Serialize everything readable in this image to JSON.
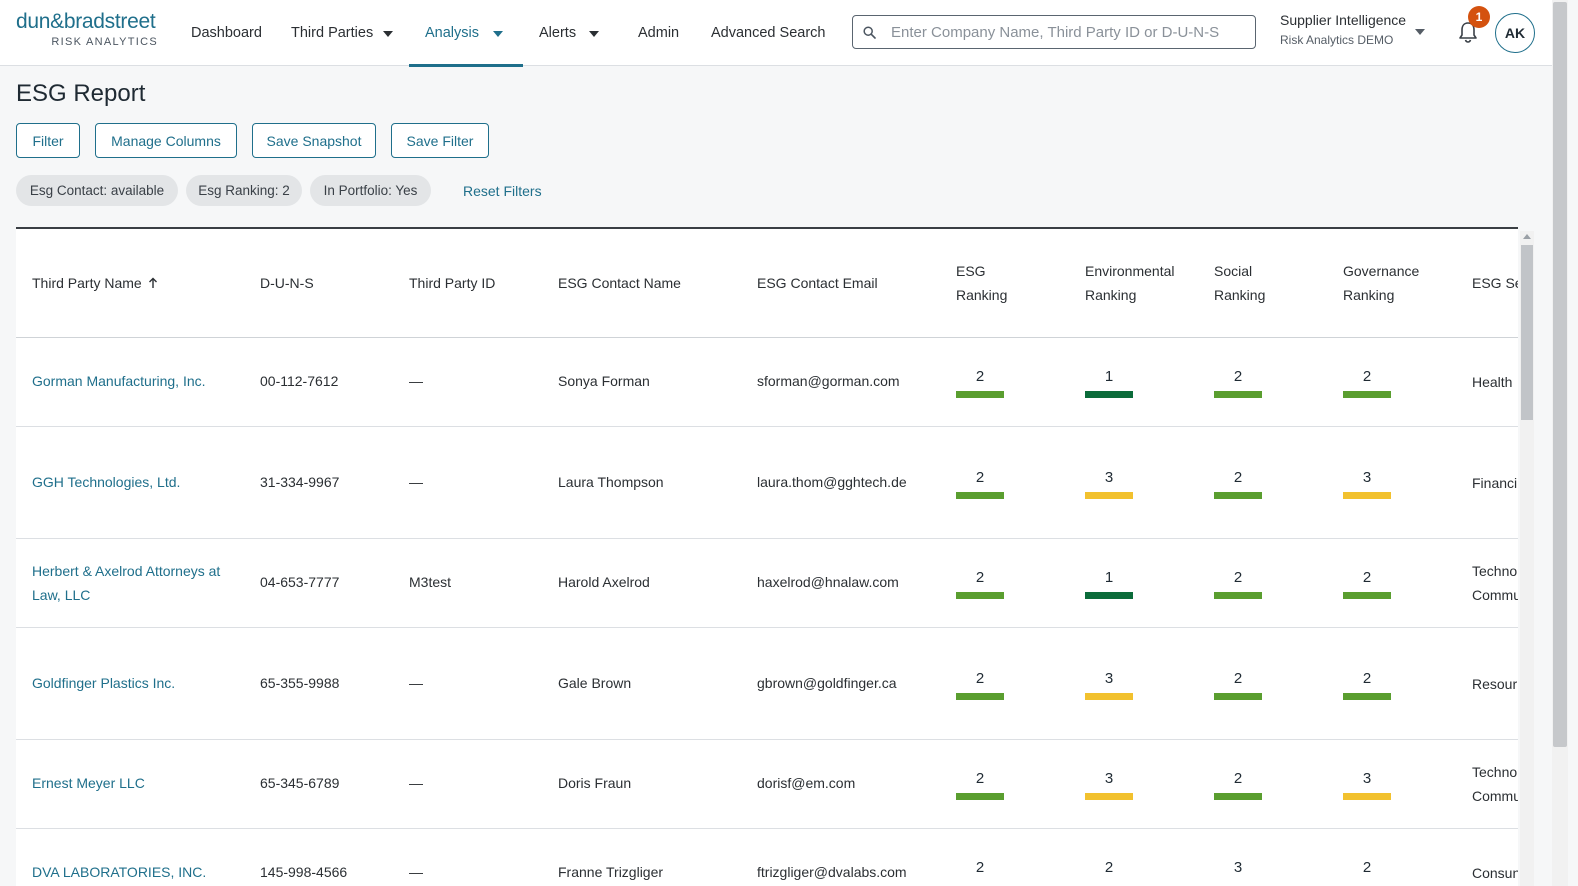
{
  "header": {
    "logo_main": "dun&bradstreet",
    "logo_sub": "RISK ANALYTICS",
    "nav": [
      {
        "label": "Dashboard"
      },
      {
        "label": "Third Parties"
      },
      {
        "label": "Analysis"
      },
      {
        "label": "Alerts"
      },
      {
        "label": "Admin"
      },
      {
        "label": "Advanced Search"
      }
    ],
    "active_nav": "Analysis",
    "search_placeholder": "Enter Company Name, Third Party ID or D-U-N-S",
    "account_name": "Supplier Intelligence",
    "account_sub": "Risk Analytics DEMO",
    "notification_count": "1",
    "avatar_initials": "AK"
  },
  "page": {
    "title": "ESG Report",
    "buttons": {
      "filter": "Filter",
      "manage_columns": "Manage Columns",
      "save_snapshot": "Save Snapshot",
      "save_filter": "Save Filter"
    },
    "chips": [
      "Esg Contact: available",
      "Esg Ranking: 2",
      "In Portfolio: Yes"
    ],
    "reset_filters": "Reset Filters"
  },
  "table": {
    "columns": {
      "name": "Third Party Name",
      "duns": "D-U-N-S",
      "tpid": "Third Party ID",
      "contact": "ESG Contact Name",
      "email": "ESG Contact Email",
      "esg_1": "ESG",
      "esg_2": "Ranking",
      "env_1": "Environmental",
      "env_2": "Ranking",
      "soc_1": "Social",
      "soc_2": "Ranking",
      "gov_1": "Governance",
      "gov_2": "Ranking",
      "sector": "ESG Se"
    },
    "rows": [
      {
        "name": "Gorman Manufacturing, Inc.",
        "duns": "00-112-7612",
        "tpid": "—",
        "contact": "Sonya Forman",
        "email": "sforman@gorman.com",
        "esg": "2",
        "env": "1",
        "soc": "2",
        "gov": "2",
        "sector_1": "Health",
        "sector_2": ""
      },
      {
        "name": "GGH Technologies, Ltd.",
        "duns": "31-334-9967",
        "tpid": "—",
        "contact": "Laura Thompson",
        "email": "laura.thom@gghtech.de",
        "esg": "2",
        "env": "3",
        "soc": "2",
        "gov": "3",
        "sector_1": "Financi",
        "sector_2": ""
      },
      {
        "name": "Herbert & Axelrod Attorneys at Law, LLC",
        "duns": "04-653-7777",
        "tpid": "M3test",
        "contact": "Harold Axelrod",
        "email": "haxelrod@hnalaw.com",
        "esg": "2",
        "env": "1",
        "soc": "2",
        "gov": "2",
        "sector_1": "Techno",
        "sector_2": "Commu"
      },
      {
        "name": "Goldfinger Plastics Inc.",
        "duns": "65-355-9988",
        "tpid": "—",
        "contact": "Gale Brown",
        "email": "gbrown@goldfinger.ca",
        "esg": "2",
        "env": "3",
        "soc": "2",
        "gov": "2",
        "sector_1": "Resour",
        "sector_2": ""
      },
      {
        "name": "Ernest Meyer LLC",
        "duns": "65-345-6789",
        "tpid": "—",
        "contact": "Doris Fraun",
        "email": "dorisf@em.com",
        "esg": "2",
        "env": "3",
        "soc": "2",
        "gov": "3",
        "sector_1": "Techno",
        "sector_2": "Commu"
      },
      {
        "name": "DVA LABORATORIES, INC.",
        "duns": "145-998-4566",
        "tpid": "—",
        "contact": "Franne Trizgliger",
        "email": "ftrizgliger@dvalabs.com",
        "esg": "2",
        "env": "2",
        "soc": "3",
        "gov": "2",
        "sector_1": "Consun",
        "sector_2": ""
      }
    ]
  },
  "rank_colors": {
    "1": "#0b6b3a",
    "2": "#5a9e2f",
    "3": "#f2c12e"
  }
}
